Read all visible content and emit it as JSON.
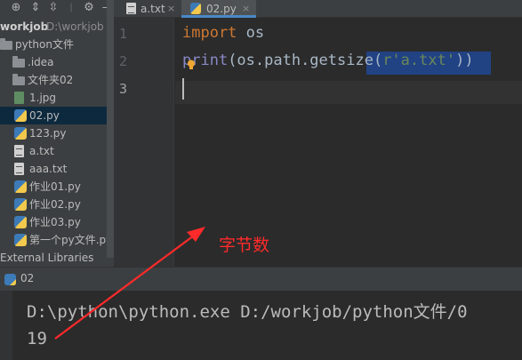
{
  "project": {
    "root_label": "workjob",
    "root_path": "D:\\workjob",
    "items": [
      {
        "label": "python文件",
        "kind": "folder"
      },
      {
        "label": ".idea",
        "kind": "folder"
      },
      {
        "label": "文件夹02",
        "kind": "folder"
      },
      {
        "label": "1.jpg",
        "kind": "image"
      },
      {
        "label": "02.py",
        "kind": "py",
        "selected": true
      },
      {
        "label": "123.py",
        "kind": "py"
      },
      {
        "label": "a.txt",
        "kind": "txt"
      },
      {
        "label": "aaa.txt",
        "kind": "txt"
      },
      {
        "label": "作业01.py",
        "kind": "py"
      },
      {
        "label": "作业02.py",
        "kind": "py"
      },
      {
        "label": "作业03.py",
        "kind": "py"
      },
      {
        "label": "第一个py文件.py",
        "kind": "py"
      }
    ],
    "external_libraries": "External Libraries"
  },
  "tabs": [
    {
      "label": "a.txt",
      "close": "×"
    },
    {
      "label": "02.py",
      "close": "×",
      "active": true
    }
  ],
  "editor": {
    "line_numbers": [
      "1",
      "2",
      "3"
    ],
    "lines": [
      {
        "kw": "import",
        "rest": " os"
      },
      {
        "builtin": "print",
        "p1": "(os.path.getsize(",
        "str": "r'a.txt'",
        "p2": "))"
      }
    ]
  },
  "run": {
    "tab_label": "02",
    "lines": [
      "D:\\python\\python.exe D:/workjob/python文件/0",
      "19"
    ]
  },
  "annotation": {
    "text": "字节数",
    "color": "#ff2a2a"
  },
  "colors": {
    "accent": "#4a88c7",
    "keyword": "#cc7832",
    "builtin": "#8888c6",
    "string": "#6a8759",
    "selection": "#214283"
  }
}
